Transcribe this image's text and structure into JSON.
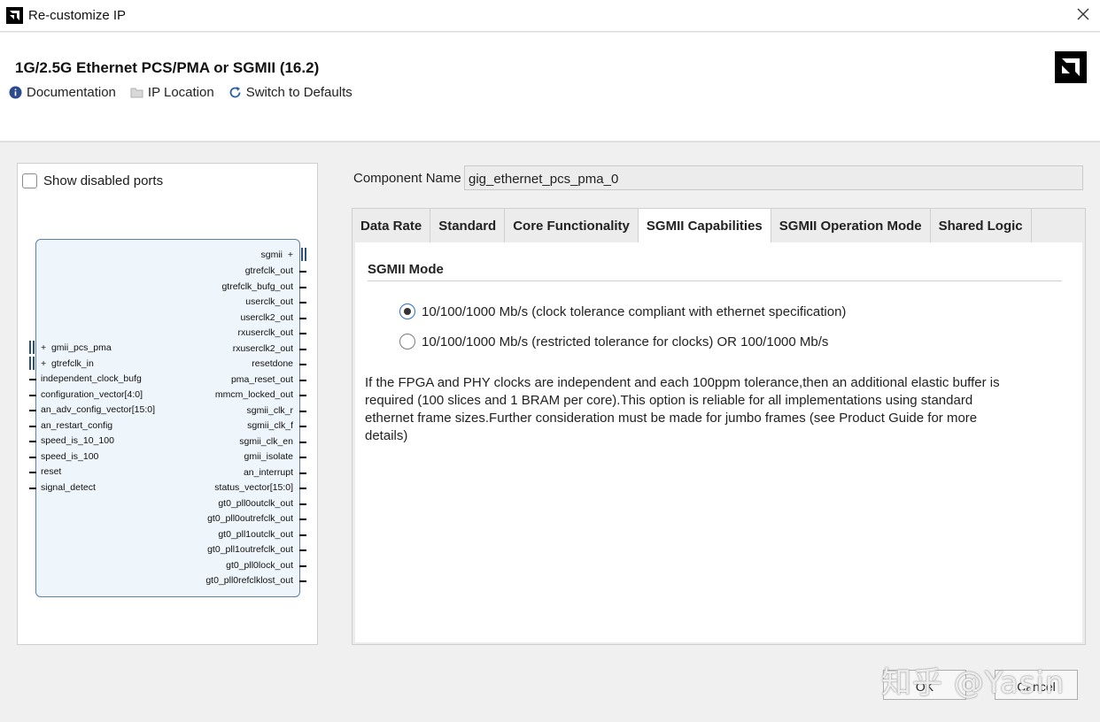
{
  "window": {
    "title": "Re-customize IP"
  },
  "header": {
    "title": "1G/2.5G Ethernet PCS/PMA or SGMII (16.2)"
  },
  "toolbar": {
    "documentation": "Documentation",
    "ip_location": "IP Location",
    "switch_defaults": "Switch to Defaults"
  },
  "left_panel": {
    "show_disabled_label": "Show disabled ports",
    "left_pins": {
      "gmii_pcs_pma": "gmii_pcs_pma",
      "gtrefclk_in": "gtrefclk_in",
      "p1": "independent_clock_bufg",
      "p2": "configuration_vector[4:0]",
      "p3": "an_adv_config_vector[15:0]",
      "p4": "an_restart_config",
      "p5": "speed_is_10_100",
      "p6": "speed_is_100",
      "p7": "reset",
      "p8": "signal_detect"
    },
    "right_pins": {
      "sgmii": "sgmii",
      "r1": "gtrefclk_out",
      "r2": "gtrefclk_bufg_out",
      "r3": "userclk_out",
      "r4": "userclk2_out",
      "r5": "rxuserclk_out",
      "r6": "rxuserclk2_out",
      "r7": "resetdone",
      "r8": "pma_reset_out",
      "r9": "mmcm_locked_out",
      "r10": "sgmii_clk_r",
      "r11": "sgmii_clk_f",
      "r12": "sgmii_clk_en",
      "r13": "gmii_isolate",
      "r14": "an_interrupt",
      "r15": "status_vector[15:0]",
      "r16": "gt0_pll0outclk_out",
      "r17": "gt0_pll0outrefclk_out",
      "r18": "gt0_pll1outclk_out",
      "r19": "gt0_pll1outrefclk_out",
      "r20": "gt0_pll0lock_out",
      "r21": "gt0_pll0refclklost_out"
    }
  },
  "component": {
    "label": "Component Name",
    "value": "gig_ethernet_pcs_pma_0"
  },
  "tabs": {
    "t1": "Data Rate",
    "t2": "Standard",
    "t3": "Core Functionality",
    "t4": "SGMII Capabilities",
    "t5": "SGMII Operation Mode",
    "t6": "Shared Logic"
  },
  "sgmii": {
    "section_title": "SGMII Mode",
    "option1": "10/100/1000 Mb/s (clock tolerance compliant with ethernet specification)",
    "option2": "10/100/1000 Mb/s (restricted tolerance for clocks) OR 100/1000 Mb/s",
    "selected": "option1",
    "description": "If the FPGA and PHY clocks are independent and each 100ppm tolerance,then an additional elastic buffer is required (100 slices and 1 BRAM per core).This option is reliable for all implementations using standard ethernet frame sizes.Further consideration must be made for jumbo frames (see Product Guide for more details)"
  },
  "buttons": {
    "ok": "OK",
    "cancel": "Cancel"
  },
  "watermark": "知乎 @Yasin",
  "colors": {
    "accent": "#2a6fc9",
    "block_fill": "#eef5fb",
    "block_border": "#5f7fa6"
  }
}
